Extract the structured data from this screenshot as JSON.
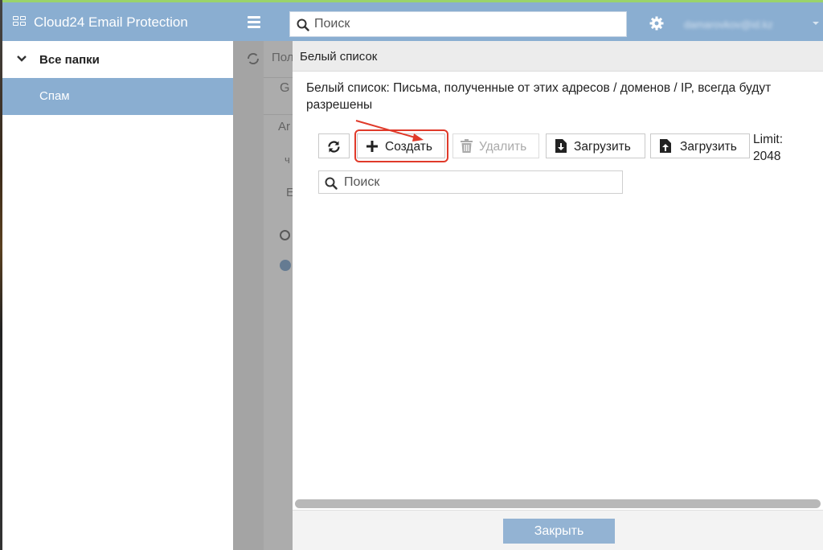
{
  "app": {
    "title": "Cloud24 Email Protection",
    "user": "damarovkov@id.kz"
  },
  "header": {
    "search_placeholder": "Поиск"
  },
  "sidebar": {
    "items": [
      {
        "label": "Все папки"
      },
      {
        "label": "Спам"
      }
    ]
  },
  "background": {
    "ghost_texts": [
      "Пол",
      "G",
      "Ar",
      "ч",
      "E"
    ]
  },
  "dialog": {
    "title": "Белый список",
    "description": "Белый список: Письма, полученные от этих адресов / доменов / IP, всегда будут разрешены",
    "toolbar": {
      "create_label": "Создать",
      "delete_label": "Удалить",
      "download_label": "Загрузить",
      "upload_label": "Загрузить",
      "limit_label": "Limit:",
      "limit_value": "2048"
    },
    "search_placeholder": "Поиск",
    "close_label": "Закрыть"
  },
  "colors": {
    "header_bg": "#8aaed1",
    "selected_bg": "#8aaed1",
    "highlight": "#e03a2a",
    "close_btn": "#93b3d3"
  },
  "icons": [
    "app-logo-icon",
    "menu-icon",
    "search-icon",
    "gear-icon",
    "chevron-down-icon",
    "refresh-icon",
    "plus-icon",
    "trash-icon",
    "download-icon",
    "upload-icon"
  ]
}
